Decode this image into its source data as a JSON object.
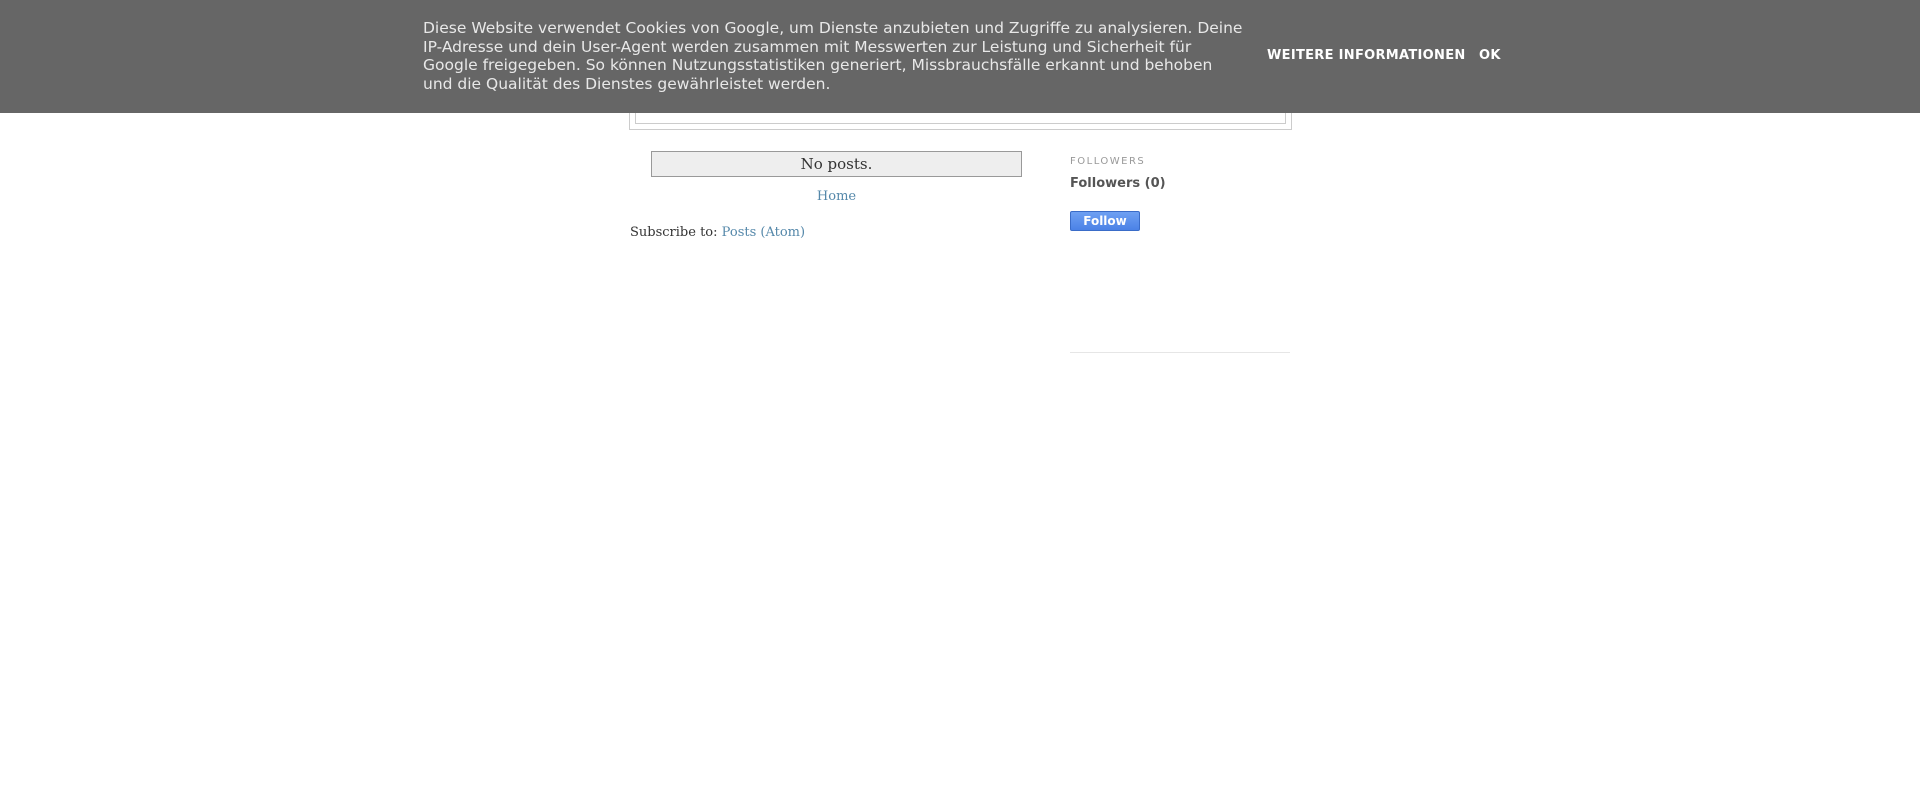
{
  "cookie_notice": {
    "text": "Diese Website verwendet Cookies von Google, um Dienste anzubieten und Zugriffe zu analysieren. Deine IP-Adresse und dein User-Agent werden zusammen mit Messwerten zur Leistung und Sicherheit für Google freigegeben. So können Nutzungsstatistiken generiert, Missbrauchsfälle erkannt und behoben und die Qualität des Dienstes gewährleistet werden.",
    "more_info_label": "WEITERE INFORMATIONEN",
    "ok_label": "OK"
  },
  "main": {
    "status_message": "No posts.",
    "home_link": "Home",
    "subscribe_prefix": "Subscribe to: ",
    "subscribe_link": "Posts (Atom)"
  },
  "sidebar": {
    "followers_heading": "FOLLOWERS",
    "followers_count": "Followers (0)",
    "follow_button": "Follow"
  },
  "colors": {
    "cookie_bar_bg": "#666666",
    "link": "#5588aa",
    "follow_button": "#4b82e6"
  }
}
